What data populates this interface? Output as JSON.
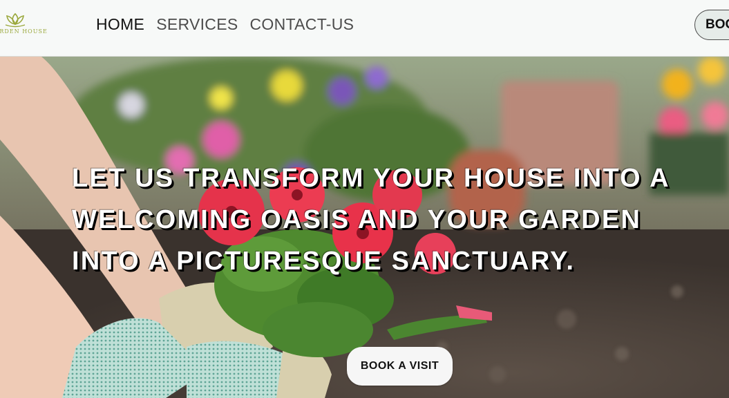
{
  "brand": {
    "logo_text": "GARDEN HOUSE",
    "logo_color": "#9aa83c"
  },
  "nav": {
    "links": [
      {
        "label": "HOME",
        "active": true
      },
      {
        "label": "SERVICES",
        "active": false
      },
      {
        "label": "CONTACT-US",
        "active": false
      }
    ],
    "cta_label": "BOOK A VISIT"
  },
  "hero": {
    "headline_lines": [
      "LET US TRANSFORM YOUR HOUSE INTO A",
      "WELCOMING OASIS AND YOUR GARDEN",
      "INTO A PICTURESQUE SANCTUARY."
    ],
    "cta_label": "BOOK A VISIT",
    "image_subject": "gloved hands planting red petunias in garden soil"
  },
  "colors": {
    "nav_background": "#f7f9f8",
    "headline_text": "#ffffff",
    "headline_shadow": "#000000",
    "cta_background": "#f6f6f6",
    "nav_cta_background": "#e6ece9"
  }
}
